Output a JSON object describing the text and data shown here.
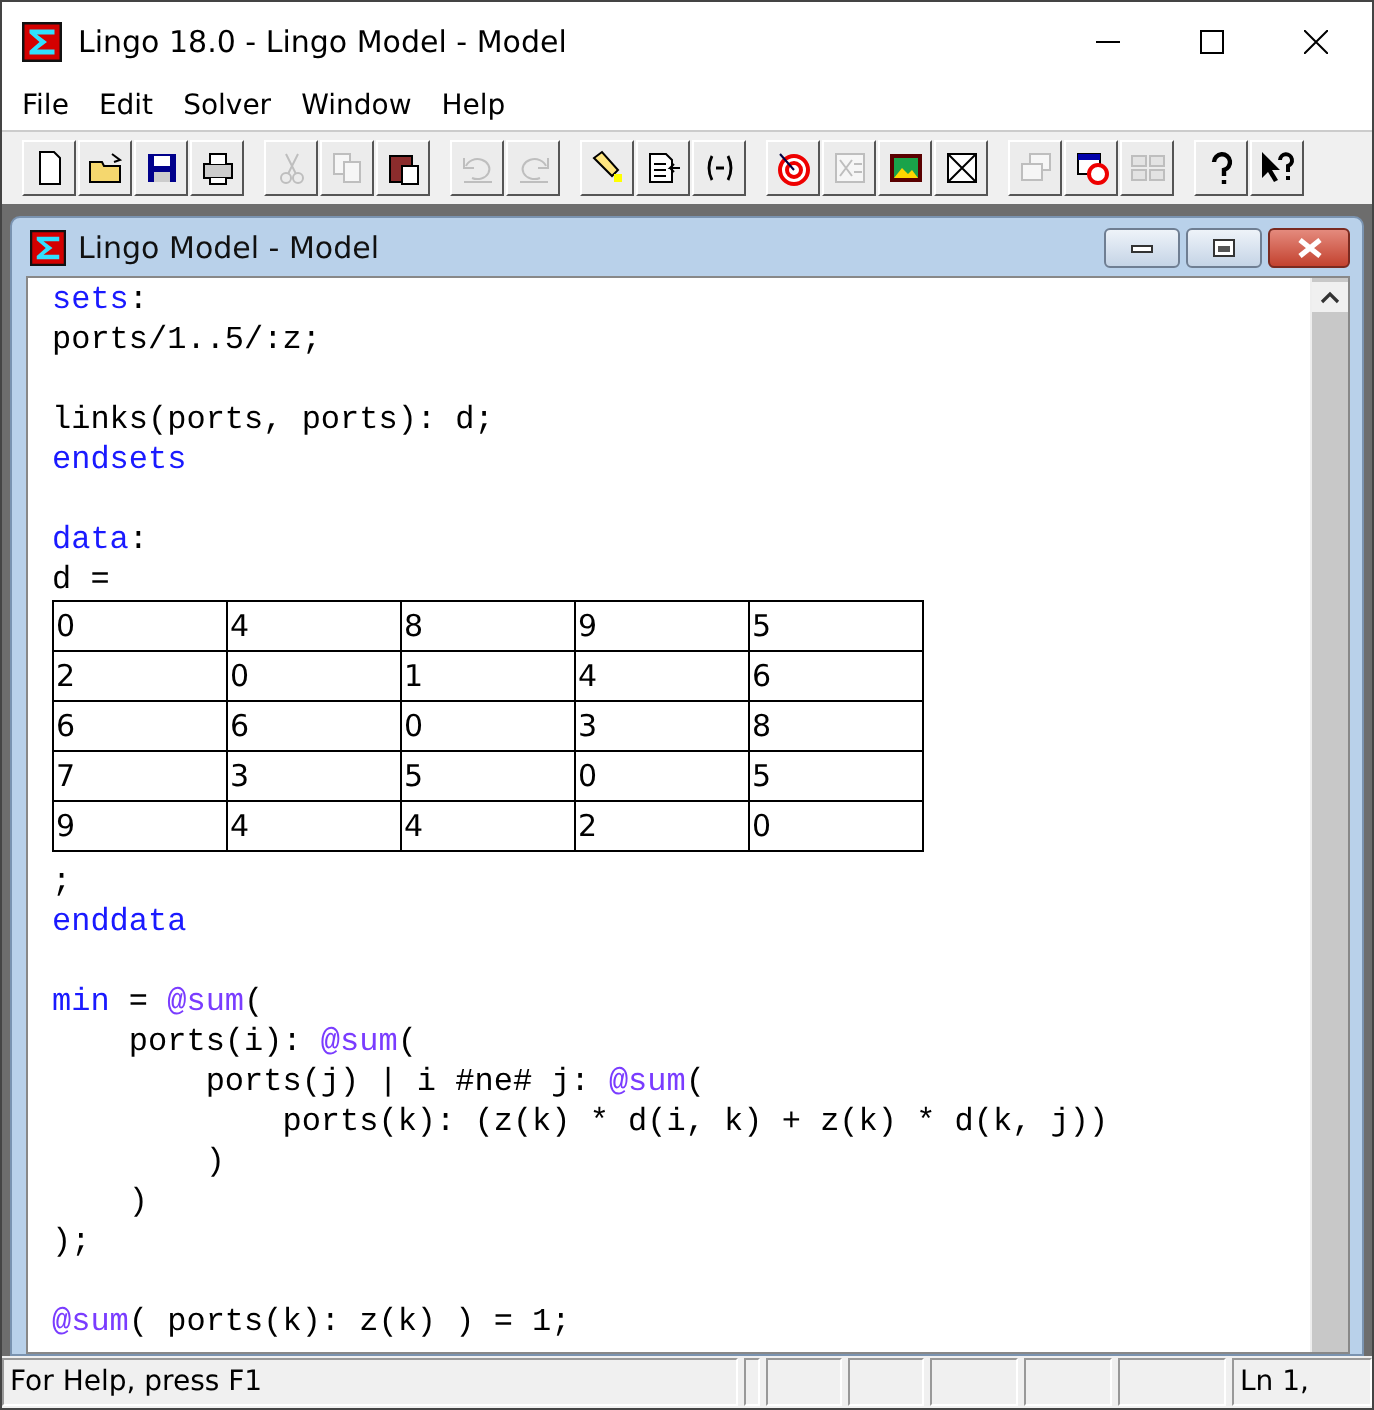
{
  "window": {
    "title": "Lingo 18.0 - Lingo Model - Model"
  },
  "menu": [
    {
      "label": "File"
    },
    {
      "label": "Edit"
    },
    {
      "label": "Solver"
    },
    {
      "label": "Window"
    },
    {
      "label": "Help"
    }
  ],
  "toolbar_groups": [
    [
      {
        "disabled": false
      },
      {
        "disabled": false
      },
      {
        "disabled": false
      },
      {
        "disabled": false
      }
    ],
    [
      {
        "disabled": true
      },
      {
        "disabled": true
      },
      {
        "disabled": false
      }
    ],
    [
      {
        "disabled": true
      },
      {
        "disabled": true
      }
    ],
    [
      {
        "disabled": false
      },
      {
        "disabled": false
      },
      {
        "disabled": false
      }
    ],
    [
      {
        "disabled": false
      },
      {
        "disabled": true
      },
      {
        "disabled": false
      },
      {
        "disabled": false
      }
    ],
    [
      {
        "disabled": true
      },
      {
        "disabled": false
      },
      {
        "disabled": true
      }
    ],
    [
      {
        "disabled": false
      },
      {
        "disabled": false
      }
    ]
  ],
  "document": {
    "title": "Lingo Model - Model",
    "lines": [
      {
        "kind": "code",
        "tokens": [
          {
            "kind": "keyword",
            "text": "sets"
          },
          {
            "kind": "plain",
            "text": ":"
          }
        ]
      },
      {
        "kind": "code",
        "tokens": [
          {
            "kind": "plain",
            "text": "ports/1..5/:z;"
          }
        ]
      },
      {
        "kind": "blank"
      },
      {
        "kind": "code",
        "tokens": [
          {
            "kind": "plain",
            "text": "links(ports, ports): d;"
          }
        ]
      },
      {
        "kind": "code",
        "tokens": [
          {
            "kind": "keyword",
            "text": "endsets"
          }
        ]
      },
      {
        "kind": "blank"
      },
      {
        "kind": "code",
        "tokens": [
          {
            "kind": "keyword",
            "text": "data"
          },
          {
            "kind": "plain",
            "text": ":"
          }
        ]
      },
      {
        "kind": "code",
        "tokens": [
          {
            "kind": "plain",
            "text": "d ="
          }
        ]
      },
      {
        "kind": "table",
        "rows": [
          [
            "0",
            "4",
            "8",
            "9",
            "5"
          ],
          [
            "2",
            "0",
            "1",
            "4",
            "6"
          ],
          [
            "6",
            "6",
            "0",
            "3",
            "8"
          ],
          [
            "7",
            "3",
            "5",
            "0",
            "5"
          ],
          [
            "9",
            "4",
            "4",
            "2",
            "0"
          ]
        ]
      },
      {
        "kind": "code",
        "tokens": [
          {
            "kind": "plain",
            "text": ";"
          }
        ]
      },
      {
        "kind": "code",
        "tokens": [
          {
            "kind": "keyword",
            "text": "enddata"
          }
        ]
      },
      {
        "kind": "blank"
      },
      {
        "kind": "code",
        "tokens": [
          {
            "kind": "keyword",
            "text": "min"
          },
          {
            "kind": "plain",
            "text": " = "
          },
          {
            "kind": "function",
            "text": "@sum"
          },
          {
            "kind": "plain",
            "text": "("
          }
        ]
      },
      {
        "kind": "code",
        "tokens": [
          {
            "kind": "plain",
            "text": "    ports(i): "
          },
          {
            "kind": "function",
            "text": "@sum"
          },
          {
            "kind": "plain",
            "text": "("
          }
        ]
      },
      {
        "kind": "code",
        "tokens": [
          {
            "kind": "plain",
            "text": "        ports(j) | i #ne# j: "
          },
          {
            "kind": "function",
            "text": "@sum"
          },
          {
            "kind": "plain",
            "text": "("
          }
        ]
      },
      {
        "kind": "code",
        "tokens": [
          {
            "kind": "plain",
            "text": "            ports(k): (z(k) * d(i, k) + z(k) * d(k, j))"
          }
        ]
      },
      {
        "kind": "code",
        "tokens": [
          {
            "kind": "plain",
            "text": "        )"
          }
        ]
      },
      {
        "kind": "code",
        "tokens": [
          {
            "kind": "plain",
            "text": "    )"
          }
        ]
      },
      {
        "kind": "code",
        "tokens": [
          {
            "kind": "plain",
            "text": ");"
          }
        ]
      },
      {
        "kind": "blank"
      },
      {
        "kind": "code",
        "tokens": [
          {
            "kind": "function",
            "text": "@sum"
          },
          {
            "kind": "plain",
            "text": "( ports(k): z(k) ) = 1;"
          }
        ]
      }
    ]
  },
  "status_bar": {
    "help": "For Help, press F1",
    "position": "Ln 1,"
  }
}
